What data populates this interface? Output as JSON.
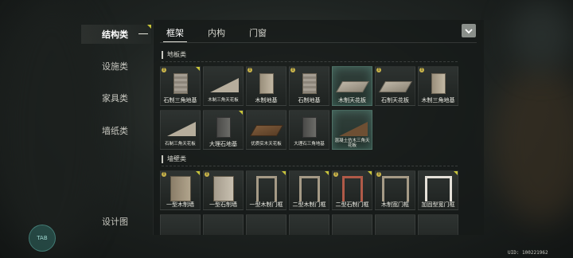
{
  "side_menu": {
    "items": [
      {
        "label": "结构类",
        "active": true
      },
      {
        "label": "设施类",
        "active": false
      },
      {
        "label": "家具类",
        "active": false
      },
      {
        "label": "墙纸类",
        "active": false
      },
      {
        "label": "设计图",
        "active": false
      }
    ]
  },
  "tabs": [
    {
      "label": "框架",
      "active": true
    },
    {
      "label": "内构",
      "active": false
    },
    {
      "label": "门窗",
      "active": false
    }
  ],
  "collapse_icon": "chevron-down-icon",
  "sections": {
    "floor": {
      "title": "地板类",
      "items": [
        {
          "name": "石制三角地基",
          "preview": "slab-stone"
        },
        {
          "name": "木制三角天花板",
          "preview": "triangle-plate"
        },
        {
          "name": "木制地基",
          "preview": "slab-wood"
        },
        {
          "name": "石制地基",
          "preview": "slab-stone"
        },
        {
          "name": "木制天花板",
          "preview": "plate",
          "selected": true
        },
        {
          "name": "石制天花板",
          "preview": "plate"
        },
        {
          "name": "木制三角地基",
          "preview": "slab-wood"
        },
        {
          "name": "石制三角天花板",
          "preview": "triangle-plate"
        },
        {
          "name": "大理石地基",
          "preview": "slab-dark"
        },
        {
          "name": "优质实木天花板",
          "preview": "plate-wood"
        },
        {
          "name": "大理石三角地基",
          "preview": "slab-dark"
        },
        {
          "name": "混凝土仿木三角天花板",
          "preview": "triangle-wood"
        }
      ]
    },
    "wall": {
      "title": "墙壁类",
      "items": [
        {
          "name": "一型木制墙",
          "preview": "wall"
        },
        {
          "name": "一型石制墙",
          "preview": "wall-light"
        },
        {
          "name": "一型木制门框",
          "preview": "door"
        },
        {
          "name": "二型木制门框",
          "preview": "door"
        },
        {
          "name": "二型石制门框",
          "preview": "door-brick"
        },
        {
          "name": "木制宽门框",
          "preview": "door-wide"
        },
        {
          "name": "加固型宽门框",
          "preview": "door-white"
        }
      ]
    }
  },
  "uid": "UID: 100221962",
  "bottom_button": "TAB",
  "colors": {
    "accent": "#c8c43a",
    "badge": "#c9b44a",
    "selected_glow": "#78c8b4"
  }
}
